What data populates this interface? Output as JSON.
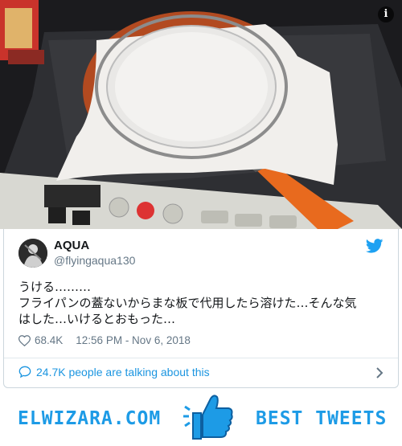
{
  "tweet": {
    "display_name": "AQUA",
    "handle": "@flyingaqua130",
    "text_lines": [
      "うける………",
      "フライパンの蓋ないからまな板で代用したら溶けた…そんな気",
      "はした…いけるとおもった…"
    ],
    "likes": "68.4K",
    "timestamp": "12:56 PM - Nov 6, 2018",
    "talking": "24.7K people are talking about this",
    "info_glyph": "i"
  },
  "banner": {
    "site": "ELWIZARA.COM",
    "tagline": "BEST TWEETS"
  },
  "colors": {
    "twitter_blue": "#1da1f2",
    "link_blue": "#1b95e0",
    "brand_blue": "#1d9be6",
    "muted": "#657786"
  },
  "icons": [
    "info-icon",
    "twitter-bird-icon",
    "heart-icon",
    "speech-bubble-icon",
    "chevron-right-icon",
    "thumbs-up-icon"
  ]
}
